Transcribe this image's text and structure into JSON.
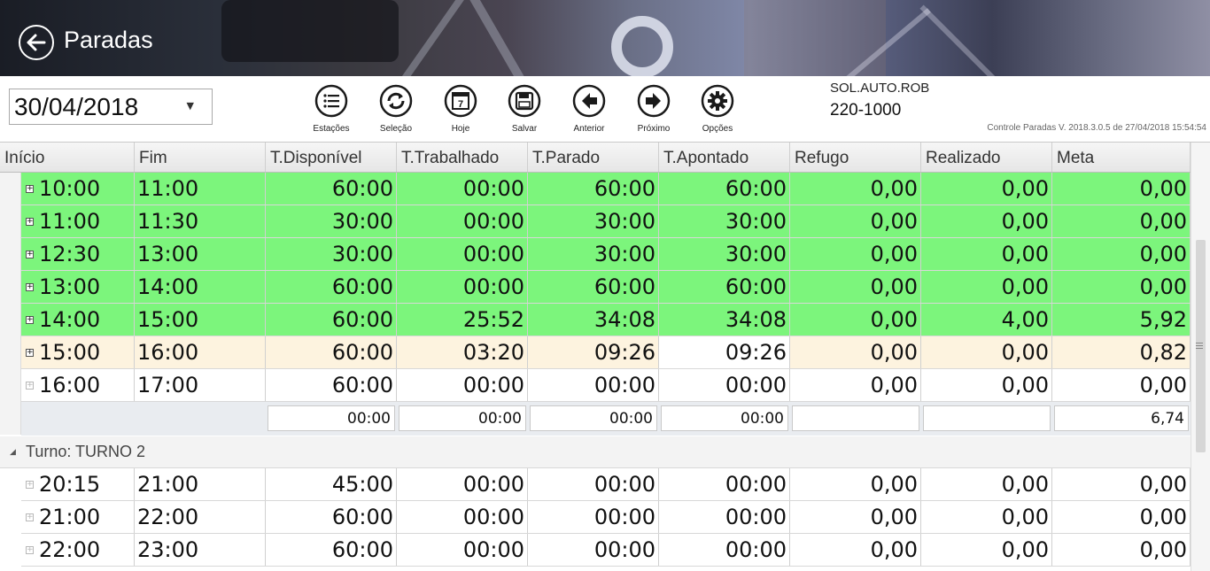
{
  "header": {
    "title": "Paradas"
  },
  "toolbar": {
    "date": "30/04/2018",
    "buttons": [
      {
        "label": "Estações",
        "icon": "list-icon"
      },
      {
        "label": "Seleção",
        "icon": "refresh-icon"
      },
      {
        "label": "Hoje",
        "icon": "calendar-icon",
        "day": "7"
      },
      {
        "label": "Salvar",
        "icon": "save-icon"
      },
      {
        "label": "Anterior",
        "icon": "arrow-left-icon"
      },
      {
        "label": "Próximo",
        "icon": "arrow-right-icon"
      },
      {
        "label": "Opções",
        "icon": "gear-icon"
      }
    ],
    "station": "SOL.AUTO.ROB",
    "code": "220-1000",
    "version": "Controle Paradas V. 2018.3.0.5 de 27/04/2018 15:54:54"
  },
  "grid": {
    "columns": [
      "Início",
      "Fim",
      "T.Disponível",
      "T.Trabalhado",
      "T.Parado",
      "T.Apontado",
      "Refugo",
      "Realizado",
      "Meta"
    ],
    "group1_rows": [
      {
        "cells": [
          "10:00",
          "11:00",
          "60:00",
          "00:00",
          "60:00",
          "60:00",
          "0,00",
          "0,00",
          "0,00"
        ],
        "status": "green"
      },
      {
        "cells": [
          "11:00",
          "11:30",
          "30:00",
          "00:00",
          "30:00",
          "30:00",
          "0,00",
          "0,00",
          "0,00"
        ],
        "status": "green"
      },
      {
        "cells": [
          "12:30",
          "13:00",
          "30:00",
          "00:00",
          "30:00",
          "30:00",
          "0,00",
          "0,00",
          "0,00"
        ],
        "status": "green"
      },
      {
        "cells": [
          "13:00",
          "14:00",
          "60:00",
          "00:00",
          "60:00",
          "60:00",
          "0,00",
          "0,00",
          "0,00"
        ],
        "status": "green"
      },
      {
        "cells": [
          "14:00",
          "15:00",
          "60:00",
          "25:52",
          "34:08",
          "34:08",
          "0,00",
          "4,00",
          "5,92"
        ],
        "status": "green"
      },
      {
        "cells": [
          "15:00",
          "16:00",
          "60:00",
          "03:20",
          "09:26",
          "09:26",
          "0,00",
          "0,00",
          "0,82"
        ],
        "status": "partial"
      },
      {
        "cells": [
          "16:00",
          "17:00",
          "60:00",
          "00:00",
          "00:00",
          "00:00",
          "0,00",
          "0,00",
          "0,00"
        ],
        "status": "white"
      }
    ],
    "summary": [
      "00:00",
      "00:00",
      "00:00",
      "00:00",
      "",
      "",
      "6,74"
    ],
    "group2_label": "Turno: TURNO 2",
    "group2_rows": [
      {
        "cells": [
          "20:15",
          "21:00",
          "45:00",
          "00:00",
          "00:00",
          "00:00",
          "0,00",
          "0,00",
          "0,00"
        ],
        "status": "white"
      },
      {
        "cells": [
          "21:00",
          "22:00",
          "60:00",
          "00:00",
          "00:00",
          "00:00",
          "0,00",
          "0,00",
          "0,00"
        ],
        "status": "white"
      },
      {
        "cells": [
          "22:00",
          "23:00",
          "60:00",
          "00:00",
          "00:00",
          "00:00",
          "0,00",
          "0,00",
          "0,00"
        ],
        "status": "white"
      }
    ]
  },
  "colors": {
    "green": "#7cf57c",
    "partial": "#fdf3df",
    "white": "#ffffff"
  }
}
